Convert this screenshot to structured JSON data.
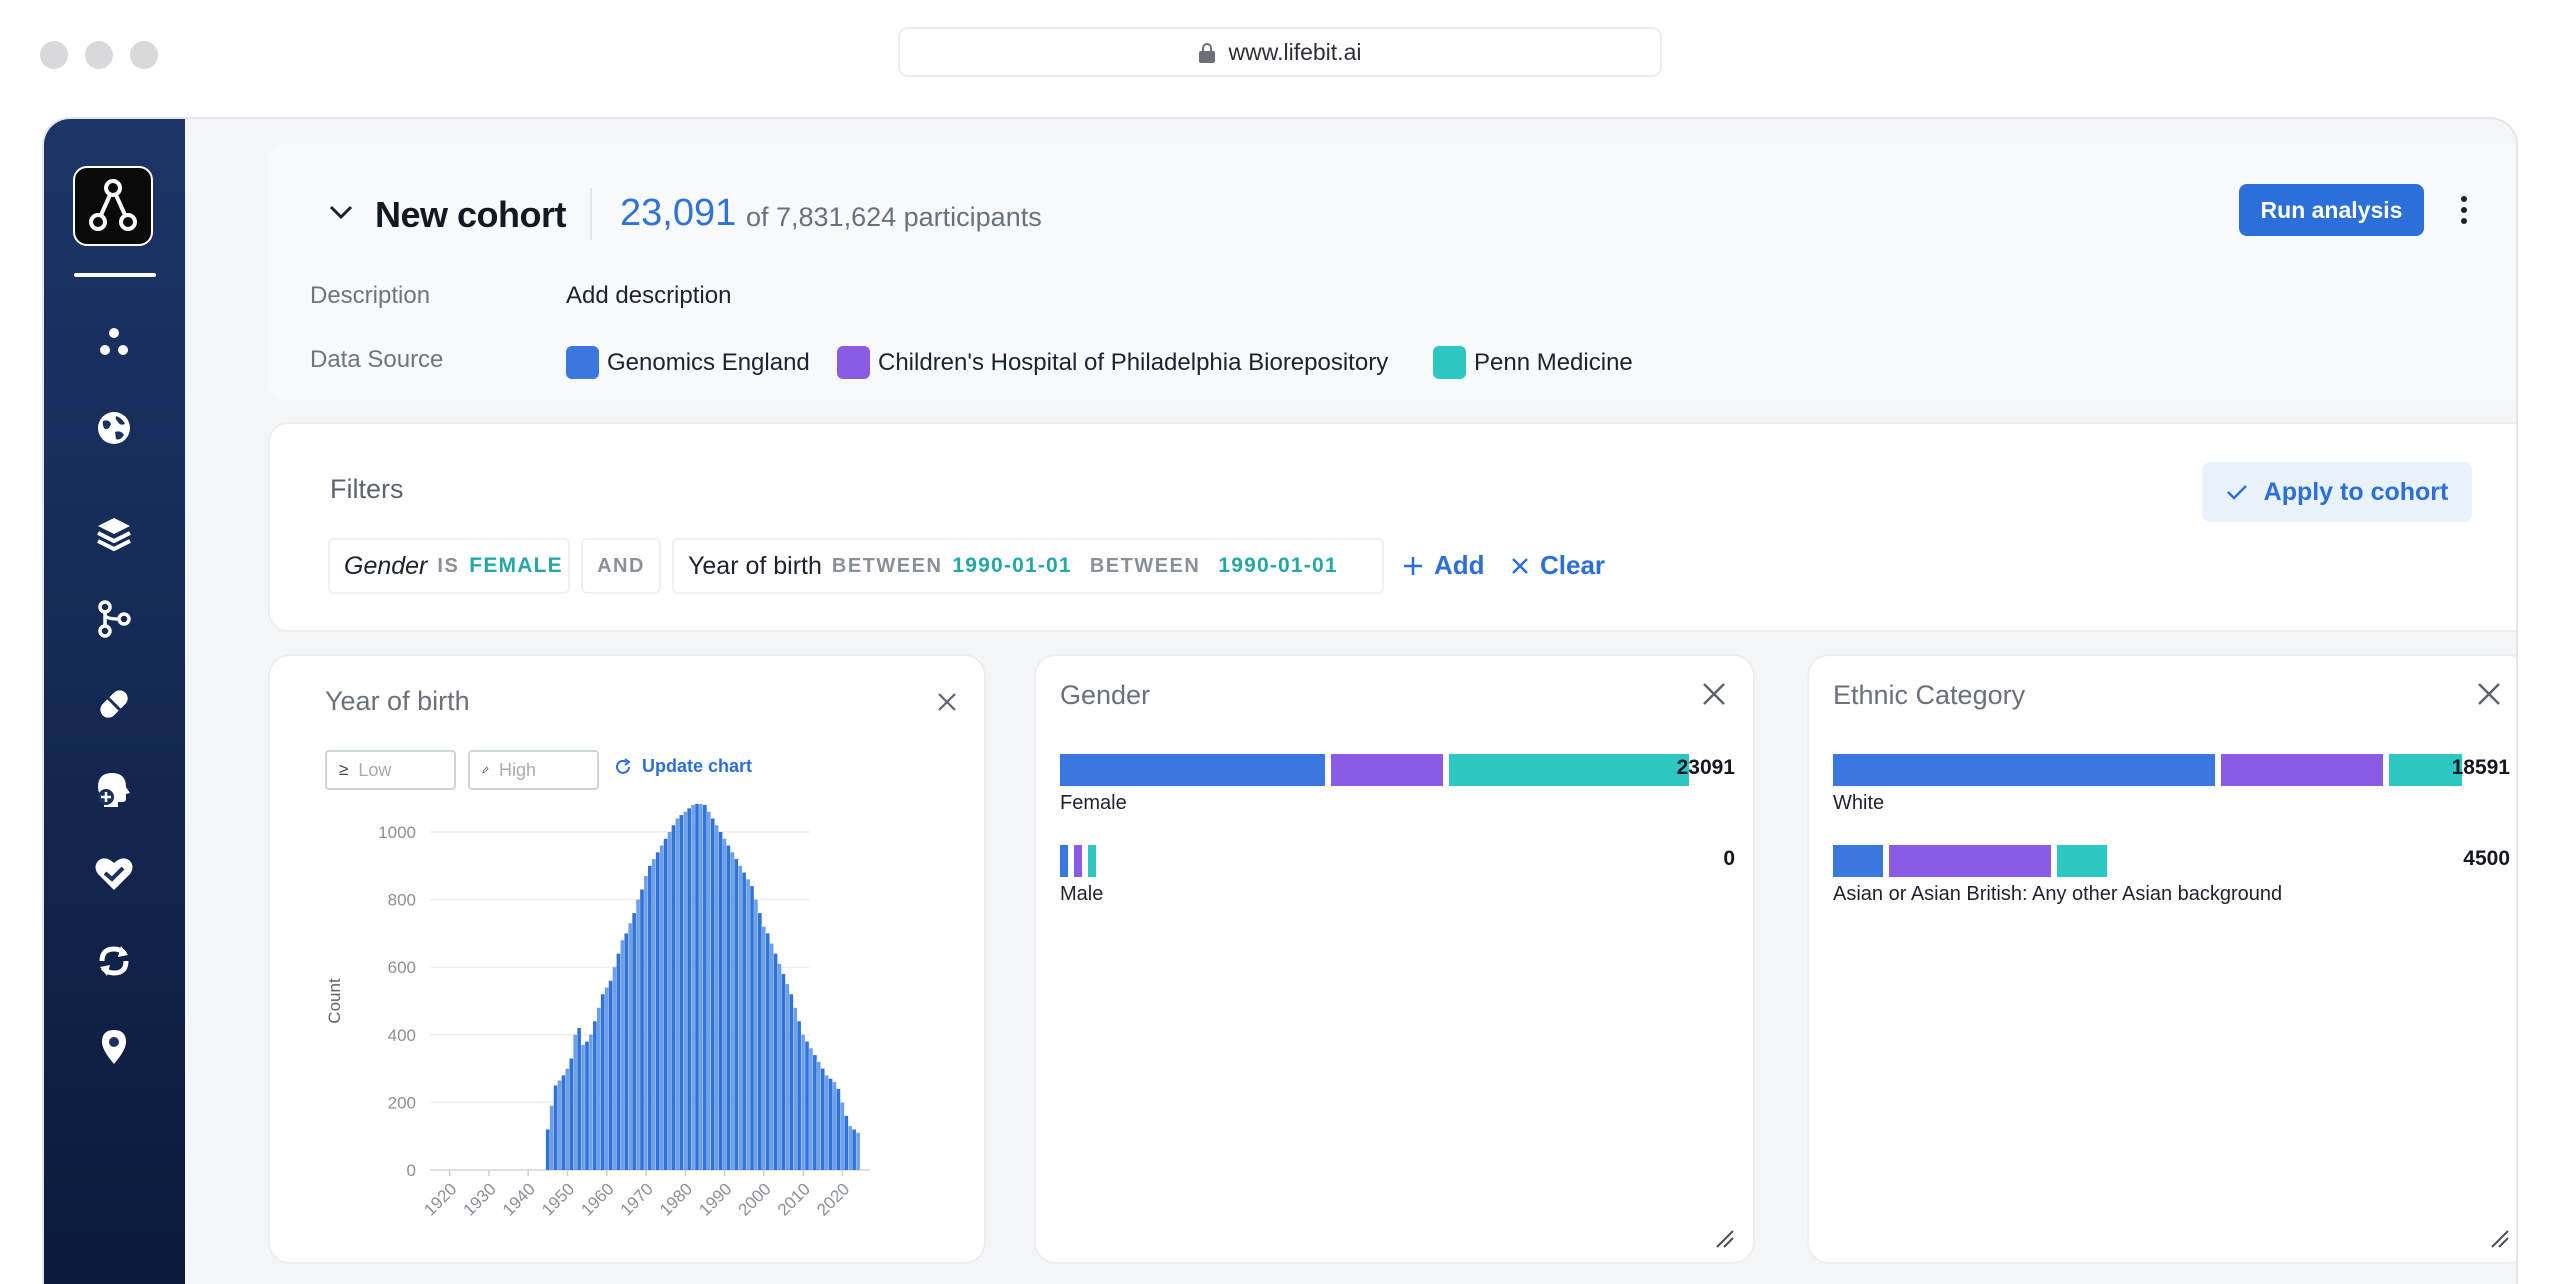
{
  "browser": {
    "url": "www.lifebit.ai"
  },
  "colors": {
    "accent": "#2c6fd9",
    "genomics_england": "#3a78e0",
    "chop": "#8c5be4",
    "penn": "#2cc6c3",
    "filter_value": "#25a7a6"
  },
  "sidebar": {
    "logo": "lifebit-logo-icon",
    "items": [
      {
        "icon": "dots-cluster-icon"
      },
      {
        "icon": "globe-icon"
      },
      {
        "icon": "layers-icon"
      },
      {
        "icon": "branch-icon"
      },
      {
        "icon": "pill-icon"
      },
      {
        "icon": "head-plus-icon"
      },
      {
        "icon": "heart-check-icon"
      },
      {
        "icon": "sync-icon"
      },
      {
        "icon": "location-pin-icon"
      }
    ]
  },
  "cohort": {
    "title": "New cohort",
    "count": "23,091",
    "of_total": "of 7,831,624 participants",
    "run_label": "Run analysis",
    "description_label": "Description",
    "description_value": "Add description",
    "data_source_label": "Data Source",
    "sources": [
      {
        "name": "Genomics England",
        "color": "#3a78e0"
      },
      {
        "name": "Children's Hospital of Philadelphia Biorepository",
        "color": "#8c5be4"
      },
      {
        "name": "Penn Medicine",
        "color": "#2cc6c3"
      }
    ]
  },
  "filters": {
    "title": "Filters",
    "apply_label": "Apply to cohort",
    "gender_field": "Gender",
    "gender_op": "IS",
    "gender_value": "FEMALE",
    "and_label": "AND",
    "yob_field": "Year of birth",
    "yob_op_1": "BETWEEN",
    "yob_value_1": "1990-01-01",
    "yob_op_2": "BETWEEN",
    "yob_value_2": "1990-01-01",
    "add_label": "Add",
    "clear_label": "Clear"
  },
  "yob_card": {
    "title": "Year of birth",
    "low_placeholder": "Low",
    "high_placeholder": "High",
    "update_label": "Update chart"
  },
  "gender_card": {
    "title": "Gender",
    "rows": [
      {
        "label": "Female",
        "total": "23091"
      },
      {
        "label": "Male",
        "total": "0"
      }
    ]
  },
  "ethnic_card": {
    "title": "Ethnic Category",
    "rows": [
      {
        "label": "White",
        "total": "18591"
      },
      {
        "label": "Asian or Asian British: Any other Asian background",
        "total": "4500"
      }
    ]
  },
  "chart_data": [
    {
      "type": "bar",
      "ylabel": "Count",
      "ylim": [
        0,
        1000
      ],
      "y_ticks": [
        "0",
        "200",
        "400",
        "600",
        "800",
        "1000"
      ],
      "x_tick_labels": [
        "1920",
        "1930",
        "1940",
        "1950",
        "1960",
        "1970",
        "1980",
        "1990",
        "2000",
        "2010",
        "2020"
      ],
      "grid": true,
      "x": [
        1945,
        1946,
        1947,
        1948,
        1949,
        1950,
        1951,
        1952,
        1953,
        1954,
        1955,
        1956,
        1957,
        1958,
        1959,
        1960,
        1961,
        1962,
        1963,
        1964,
        1965,
        1966,
        1967,
        1968,
        1969,
        1970,
        1971,
        1972,
        1973,
        1974,
        1975,
        1976,
        1977,
        1978,
        1979,
        1980,
        1981,
        1982,
        1983,
        1984,
        1985,
        1986,
        1987,
        1988,
        1989,
        1990,
        1991,
        1992,
        1993,
        1994,
        1995,
        1996,
        1997,
        1998,
        1999,
        2000,
        2001,
        2002,
        2003,
        2004,
        2005,
        2006,
        2007,
        2008,
        2009,
        2010,
        2011,
        2012,
        2013,
        2014,
        2015,
        2016,
        2017,
        2018,
        2019,
        2020,
        2021,
        2022,
        2023,
        2024
      ],
      "values": [
        120,
        190,
        250,
        265,
        280,
        300,
        330,
        400,
        420,
        370,
        380,
        400,
        440,
        480,
        520,
        540,
        560,
        600,
        640,
        680,
        700,
        730,
        760,
        800,
        830,
        870,
        900,
        920,
        940,
        960,
        980,
        1000,
        1020,
        1040,
        1050,
        1060,
        1070,
        1080,
        1090,
        1095,
        1080,
        1060,
        1040,
        1020,
        1000,
        980,
        960,
        940,
        920,
        900,
        880,
        860,
        840,
        800,
        760,
        720,
        700,
        670,
        640,
        610,
        580,
        550,
        520,
        480,
        440,
        400,
        380,
        360,
        340,
        320,
        300,
        280,
        270,
        260,
        240,
        200,
        160,
        130,
        120,
        110
      ]
    },
    {
      "type": "bar",
      "title": "Gender",
      "categories": [
        "Female",
        "Male"
      ],
      "totals": [
        23091,
        0
      ],
      "series": [
        {
          "name": "Genomics England",
          "values": [
            9900,
            0
          ]
        },
        {
          "name": "Children's Hospital of Philadelphia Biorepository",
          "values": [
            4200,
            0
          ]
        },
        {
          "name": "Penn Medicine",
          "values": [
            8991,
            0
          ]
        }
      ]
    },
    {
      "type": "bar",
      "title": "Ethnic Category",
      "categories": [
        "White",
        "Asian or Asian British: Any other Asian background"
      ],
      "totals": [
        18591,
        4500
      ],
      "series": [
        {
          "name": "Genomics England",
          "values": [
            9900,
            1300
          ]
        },
        {
          "name": "Children's Hospital of Philadelphia Biorepository",
          "values": [
            4200,
            4200
          ]
        },
        {
          "name": "Penn Medicine",
          "values": [
            1900,
            1300
          ]
        }
      ]
    }
  ]
}
